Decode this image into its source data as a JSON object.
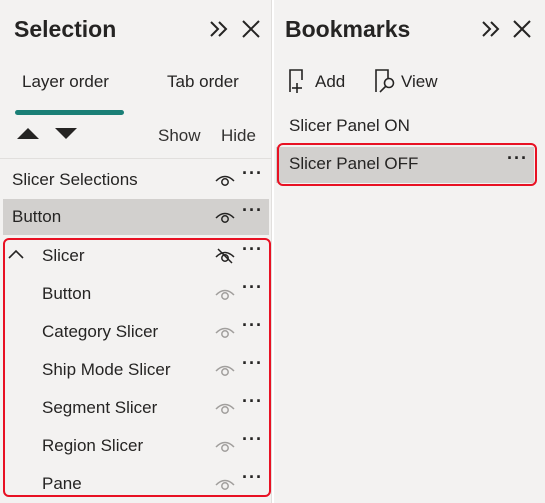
{
  "selection": {
    "title": "Selection",
    "tabs": [
      {
        "label": "Layer order",
        "active": true
      },
      {
        "label": "Tab order",
        "active": false
      }
    ],
    "show_label": "Show",
    "hide_label": "Hide",
    "items": [
      {
        "label": "Slicer Selections",
        "visible": true,
        "selected": false,
        "level": 0
      },
      {
        "label": "Button",
        "visible": true,
        "selected": true,
        "level": 0
      },
      {
        "label": "Slicer",
        "visible": false,
        "selected": false,
        "level": 0,
        "group": true,
        "expanded": true
      },
      {
        "label": "Button",
        "visible": true,
        "selected": false,
        "level": 1
      },
      {
        "label": "Category Slicer",
        "visible": true,
        "selected": false,
        "level": 1
      },
      {
        "label": "Ship Mode Slicer",
        "visible": true,
        "selected": false,
        "level": 1
      },
      {
        "label": "Segment Slicer",
        "visible": true,
        "selected": false,
        "level": 1
      },
      {
        "label": "Region Slicer",
        "visible": true,
        "selected": false,
        "level": 1
      },
      {
        "label": "Pane",
        "visible": true,
        "selected": false,
        "level": 1
      }
    ]
  },
  "bookmarks": {
    "title": "Bookmarks",
    "add_label": "Add",
    "view_label": "View",
    "items": [
      {
        "label": "Slicer Panel ON",
        "selected": false
      },
      {
        "label": "Slicer Panel OFF",
        "selected": true
      }
    ]
  },
  "more_glyph": "···",
  "colors": {
    "accent": "#1a7f76",
    "highlight": "#e81123",
    "selected_row": "#d2d0ce",
    "pane_bg": "#f3f2f1"
  }
}
